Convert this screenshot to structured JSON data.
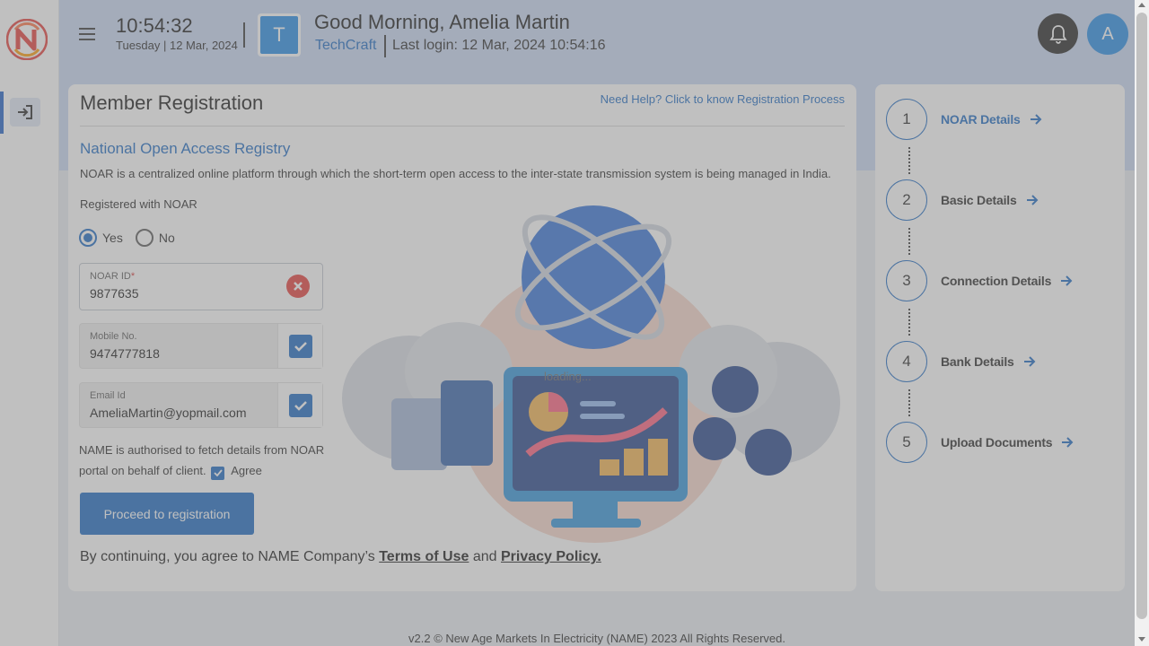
{
  "header": {
    "time": "10:54:32",
    "date": "Tuesday |  12 Mar, 2024",
    "org_initial": "T",
    "greeting": "Good Morning, Amelia Martin",
    "company": "TechCraft",
    "last_login": "Last login: 12 Mar, 2024 10:54:16",
    "user_initial": "A"
  },
  "form": {
    "title": "Member Registration",
    "help_link": "Need Help? Click to know Registration Process",
    "subtitle": "National Open Access Registry",
    "description": "NOAR is a centralized online platform through which the short-term open access to the inter-state transmission system is being managed in India.",
    "registered_label": "Registered with NOAR",
    "radio_yes": "Yes",
    "radio_no": "No",
    "selected": "Yes",
    "noar_label": "NOAR ID",
    "noar_required": "*",
    "noar_value": "9877635",
    "mobile_label": "Mobile No.",
    "mobile_value": "9474777818",
    "email_label": "Email Id",
    "email_value": "AmeliaMartin@yopmail.com",
    "consent_text": "NAME is authorised to fetch details from NOAR portal on behalf of client.",
    "agree_label": "Agree",
    "proceed_button": "Proceed to registration",
    "terms_prefix": "By continuing, you agree to NAME Company’s ",
    "terms_link": "Terms of Use",
    "terms_and": " and ",
    "privacy_link": "Privacy Policy."
  },
  "loading_text": "loading...",
  "steps": [
    {
      "number": "1",
      "label": "NOAR Details",
      "active": true
    },
    {
      "number": "2",
      "label": "Basic Details",
      "active": false
    },
    {
      "number": "3",
      "label": "Connection Details",
      "active": false
    },
    {
      "number": "4",
      "label": "Bank Details",
      "active": false
    },
    {
      "number": "5",
      "label": "Upload Documents",
      "active": false
    }
  ],
  "footer": "v2.2 © New Age Markets In Electricity (NAME) 2023 All Rights Reserved.",
  "colors": {
    "accent": "#1565c0",
    "header_band": "#c7d7f2",
    "error": "#e53935"
  }
}
